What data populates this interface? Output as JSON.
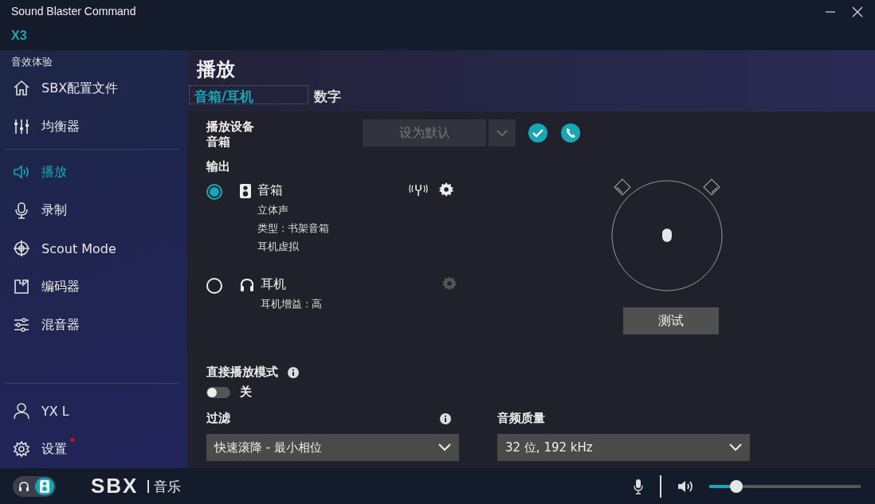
{
  "window": {
    "title": "Sound Blaster Command",
    "device": "X3"
  },
  "sidebar": {
    "section": "音效体验",
    "groups": [
      [
        {
          "label": "SBX配置文件",
          "kind": "home",
          "selected": false
        },
        {
          "label": "均衡器",
          "kind": "equalizer",
          "selected": false
        }
      ],
      [
        {
          "label": "播放",
          "kind": "speaker",
          "selected": true
        },
        {
          "label": "录制",
          "kind": "mic",
          "selected": false
        },
        {
          "label": "Scout Mode",
          "kind": "target",
          "selected": false
        },
        {
          "label": "编码器",
          "kind": "encoder",
          "selected": false
        },
        {
          "label": "混音器",
          "kind": "mixer",
          "selected": false
        }
      ]
    ],
    "footer": [
      {
        "label": "YX L",
        "kind": "user",
        "selected": false,
        "notification": false
      },
      {
        "label": "设置",
        "kind": "gear",
        "selected": false,
        "notification": true
      }
    ]
  },
  "main": {
    "title": "播放",
    "tabs": [
      {
        "label": "音箱/耳机",
        "selected": true
      },
      {
        "label": "数字",
        "selected": false
      }
    ],
    "device": {
      "label": "播放设备",
      "value": "音箱",
      "default_button": {
        "label": "设为默认",
        "disabled": true
      }
    },
    "output": {
      "heading": "输出",
      "options": [
        {
          "kind": "speaker",
          "label": "音箱",
          "selected": true,
          "details": [
            "立体声",
            "类型 : 书架音箱",
            "耳机虚拟"
          ],
          "settings_disabled": false
        },
        {
          "kind": "headphones",
          "label": "耳机",
          "selected": false,
          "details": [
            "耳机增益 : 高"
          ],
          "settings_disabled": true
        }
      ]
    },
    "test_button": "测试",
    "direct_mode": {
      "label": "直接播放模式",
      "on": false,
      "state_label": "关"
    },
    "filter": {
      "label": "过滤",
      "value": "快速滚降 - 最小相位"
    },
    "quality": {
      "label": "音频质量",
      "value": "32 位, 192 kHz"
    }
  },
  "bottom_bar": {
    "output_modes": [
      {
        "kind": "headphones",
        "selected": false
      },
      {
        "kind": "speaker",
        "selected": true
      }
    ],
    "brand": "SBX",
    "mode": "音乐",
    "volume": {
      "level": 0.18
    }
  }
}
